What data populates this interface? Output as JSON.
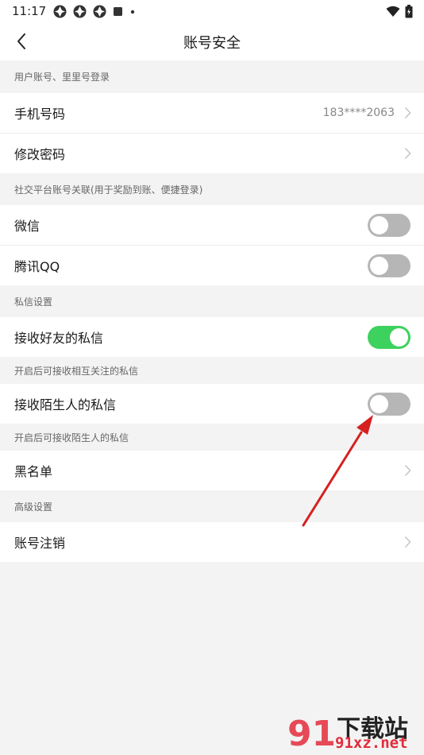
{
  "status_bar": {
    "time": "11:17",
    "icons": [
      "app-notification-icon",
      "app-notification-icon",
      "app-notification-icon",
      "stop-icon",
      "dot-icon",
      "wifi-icon",
      "battery-icon"
    ]
  },
  "header": {
    "title": "账号安全",
    "back_icon": "chevron-left-icon"
  },
  "sections": [
    {
      "header": "用户账号、里里号登录",
      "rows": [
        {
          "label": "手机号码",
          "value": "183****2063",
          "type": "link"
        },
        {
          "label": "修改密码",
          "type": "link"
        }
      ]
    },
    {
      "header": "社交平台账号关联(用于奖励到账、便捷登录)",
      "rows": [
        {
          "label": "微信",
          "type": "toggle",
          "checked": false
        },
        {
          "label": "腾讯QQ",
          "type": "toggle",
          "checked": false
        }
      ]
    },
    {
      "header": "私信设置",
      "rows": [
        {
          "label": "接收好友的私信",
          "type": "toggle",
          "checked": true
        }
      ]
    },
    {
      "header": "开启后可接收相互关注的私信",
      "rows": [
        {
          "label": "接收陌生人的私信",
          "type": "toggle",
          "checked": false
        }
      ]
    },
    {
      "header": "开启后可接收陌生人的私信",
      "rows": [
        {
          "label": "黑名单",
          "type": "link"
        }
      ]
    },
    {
      "header": "高级设置",
      "rows": [
        {
          "label": "账号注销",
          "type": "link"
        }
      ]
    }
  ],
  "colors": {
    "toggle_on": "#3dd15e",
    "toggle_off": "#b6b6b6",
    "annotation_arrow": "#d62020",
    "page_background": "#f3f3f3"
  },
  "watermark": {
    "logo": "91",
    "name": "下载站",
    "domain": "91xz.net"
  }
}
